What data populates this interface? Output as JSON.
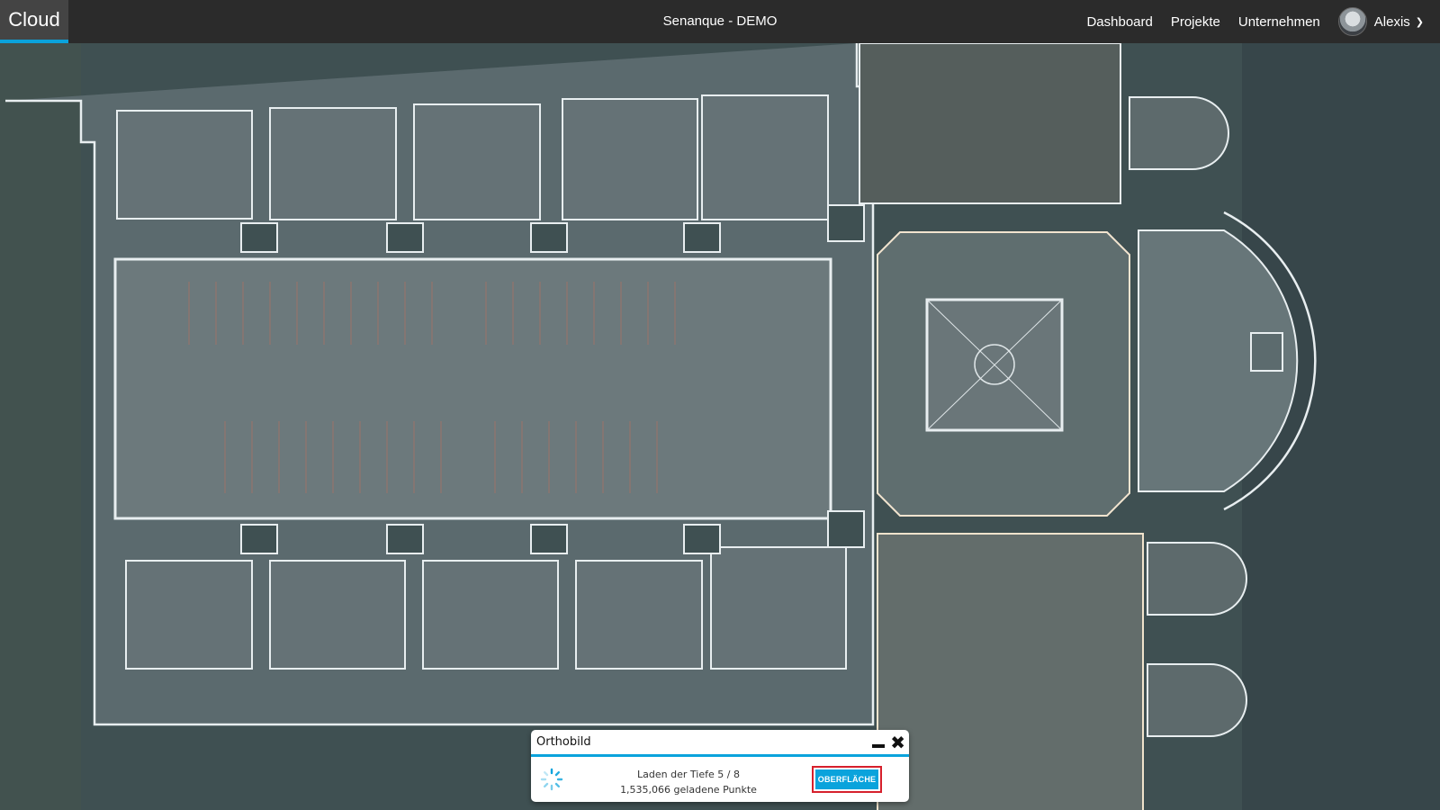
{
  "app": {
    "brand": "Cloud",
    "title": "Senanque - DEMO"
  },
  "nav": {
    "items": [
      {
        "label": "Dashboard"
      },
      {
        "label": "Projekte"
      },
      {
        "label": "Unternehmen"
      }
    ],
    "user": {
      "name": "Alexis",
      "icon": "chevron-down-icon"
    }
  },
  "panel": {
    "title": "Orthobild",
    "status_line1": "Laden der Tiefe 5 / 8",
    "status_line2": "1,535,066 geladene Punkte",
    "button_label": "OBERFLÄCHE"
  },
  "colors": {
    "accent": "#0aa3dc",
    "topbar": "#2b2b2b",
    "highlight": "#d6202c",
    "map_bg": "#3f5052"
  },
  "map": {
    "depth_loaded": 5,
    "depth_total": 8,
    "points_loaded": 1535066
  }
}
